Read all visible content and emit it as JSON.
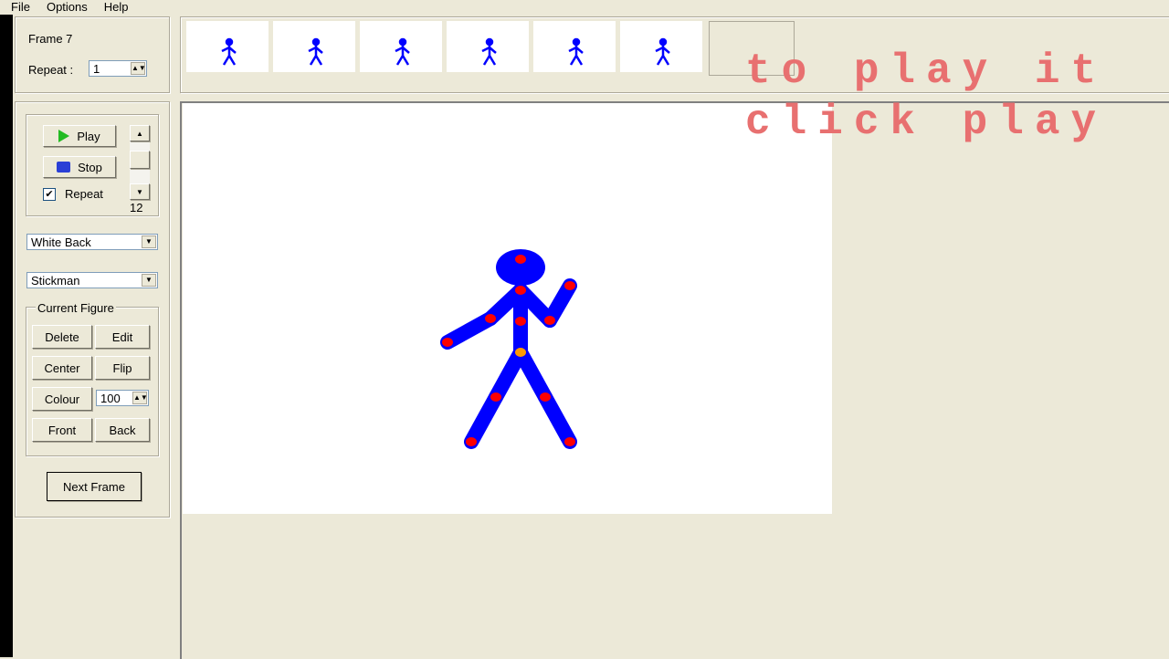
{
  "menu": [
    "File",
    "Options",
    "Help"
  ],
  "frame": {
    "label": "Frame 7",
    "repeat_label": "Repeat :",
    "repeat_value": "1"
  },
  "playback": {
    "play": "Play",
    "stop": "Stop",
    "repeat": "Repeat",
    "repeat_checked": true,
    "speed": "12"
  },
  "background_select": "White Back",
  "figure_select": "Stickman",
  "current_figure": {
    "title": "Current Figure",
    "delete": "Delete",
    "edit": "Edit",
    "center": "Center",
    "flip": "Flip",
    "colour": "Colour",
    "size": "100",
    "front": "Front",
    "back": "Back"
  },
  "next_frame": "Next Frame",
  "timeline": {
    "frames": 6
  },
  "overlay": {
    "line1": "to play it",
    "line2": "click play"
  },
  "colors": {
    "figure": "#0000ff",
    "joint": "#ff0000",
    "center_joint": "#ff9900",
    "overlay": "#e87070"
  }
}
